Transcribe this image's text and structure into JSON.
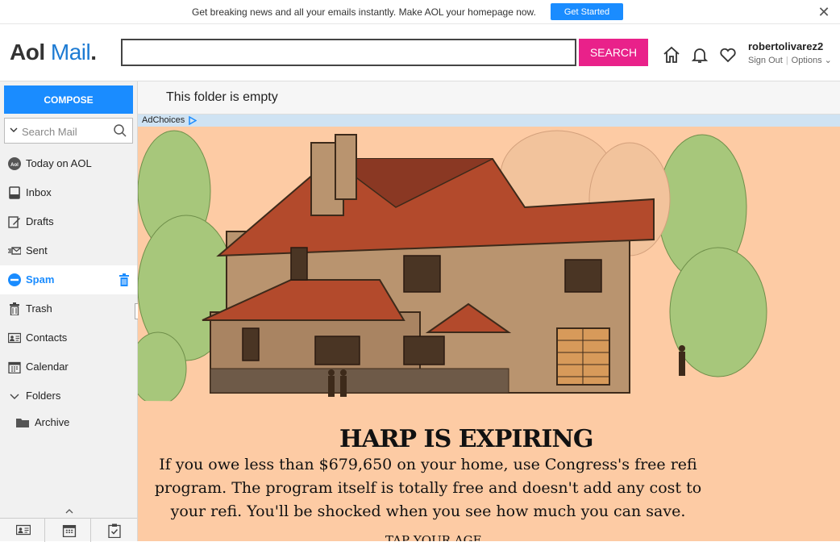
{
  "promo": {
    "text": "Get breaking news and all your emails instantly. Make AOL your homepage now.",
    "button": "Get Started",
    "close_icon": "close-icon"
  },
  "header": {
    "logo_aol": "Aol",
    "logo_mail": "Mail",
    "logo_dot": ".",
    "search_value": "",
    "search_button": "SEARCH",
    "username": "robertolivarez2",
    "sign_out": "Sign Out",
    "options": "Options"
  },
  "sidebar": {
    "compose": "COMPOSE",
    "search_placeholder": "Search Mail",
    "items": [
      {
        "label": "Today on AOL",
        "icon": "aol-icon"
      },
      {
        "label": "Inbox",
        "icon": "inbox-icon"
      },
      {
        "label": "Drafts",
        "icon": "drafts-icon"
      },
      {
        "label": "Sent",
        "icon": "sent-icon"
      },
      {
        "label": "Spam",
        "icon": "spam-icon",
        "active": true
      },
      {
        "label": "Trash",
        "icon": "trash-icon"
      },
      {
        "label": "Contacts",
        "icon": "contacts-icon"
      },
      {
        "label": "Calendar",
        "icon": "calendar-icon"
      },
      {
        "label": "Folders",
        "icon": "chevron-down-icon"
      },
      {
        "label": "Archive",
        "icon": "folder-icon"
      }
    ]
  },
  "main": {
    "empty_message": "This folder is empty",
    "adchoices": "AdChoices",
    "ad": {
      "headline": "HARP IS EXPIRING",
      "body": "If you owe less than $679,650 on your home, use Congress's free refi program. The program itself is totally free and doesn't add any cost to your refi. You'll be shocked when you see how much you can save.",
      "cta": "TAP YOUR AGE"
    }
  },
  "colors": {
    "accent": "#1a8cff",
    "search_button": "#e9218a",
    "ad_background": "#fdcba4"
  }
}
